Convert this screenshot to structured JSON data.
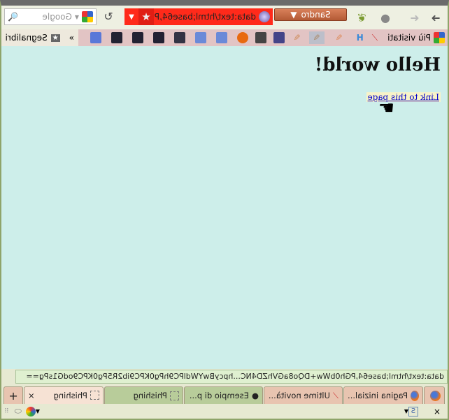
{
  "toolbar": {
    "profile_label": "Sandro",
    "url": "data:text/html;base64,P",
    "search_placeholder": "Google"
  },
  "bookmarks": {
    "most_visited": "Più visitati",
    "bookmarks_menu": "Segnalibri",
    "overflow": "»"
  },
  "page": {
    "heading": "Hello world!",
    "link": "Link to this page"
  },
  "status": "data:text/html;base64,PGh0bWw+DQo8aGVhZD4NC...hpcyBwYWdlPC9hPg0KPC9ib2R5Pg0KPC9odG1sPg==",
  "tabs": [
    {
      "label": "Pagina inizial..."
    },
    {
      "label": "Ultime novità..."
    },
    {
      "label": "Esempio di p..."
    },
    {
      "label": "Phishing"
    },
    {
      "label": "Phishing",
      "active": true
    }
  ],
  "colors": {
    "urlbar": "#ff2a1a",
    "content_bg": "#cdeeea"
  }
}
